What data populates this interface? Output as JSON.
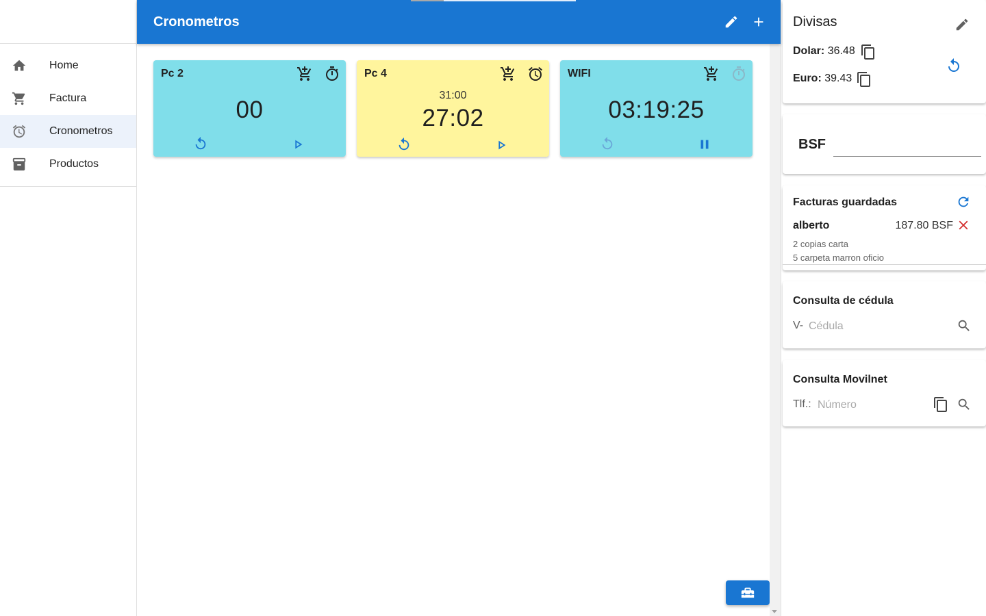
{
  "sidebar": {
    "items": [
      {
        "label": "Home",
        "icon": "home-icon",
        "active": false
      },
      {
        "label": "Factura",
        "icon": "cart-icon",
        "active": false
      },
      {
        "label": "Cronometros",
        "icon": "alarm-icon",
        "active": true
      },
      {
        "label": "Productos",
        "icon": "archive-icon",
        "active": false
      }
    ]
  },
  "header": {
    "title": "Cronometros",
    "edit_icon": "pencil-icon",
    "add_icon": "plus-icon"
  },
  "timers": [
    {
      "name": "Pc 2",
      "target": "",
      "time": "00",
      "color": "#80deea",
      "clock_icon": "stopwatch-icon",
      "action_icon": "play-icon",
      "reset_disabled": false
    },
    {
      "name": "Pc 4",
      "target": "31:00",
      "time": "27:02",
      "color": "#fff59d",
      "clock_icon": "alarm-icon",
      "action_icon": "play-icon",
      "reset_disabled": false
    },
    {
      "name": "WIFI",
      "target": "",
      "time": "03:19:25",
      "color": "#80deea",
      "clock_icon": "stopwatch-icon",
      "action_icon": "pause-icon",
      "reset_disabled": true
    }
  ],
  "divisas": {
    "title": "Divisas",
    "dolar_label": "Dolar:",
    "dolar_value": "36.48",
    "euro_label": "Euro:",
    "euro_value": "39.43"
  },
  "bsf": {
    "label": "BSF",
    "value": ""
  },
  "facturas": {
    "title": "Facturas guardadas",
    "items": [
      {
        "name": "alberto",
        "amount": "187.80 BSF",
        "lines": [
          "2 copias carta",
          "5 carpeta marron oficio"
        ]
      }
    ]
  },
  "cedula": {
    "title": "Consulta de cédula",
    "prefix": "V-",
    "placeholder": "Cédula"
  },
  "movilnet": {
    "title": "Consulta Movilnet",
    "prefix": "Tlf.:",
    "placeholder": "Número"
  },
  "colors": {
    "primary": "#1976d2",
    "danger": "#d32f2f",
    "timer_cyan": "#80deea",
    "timer_yellow": "#fff59d"
  },
  "loading_progress": 0.2
}
